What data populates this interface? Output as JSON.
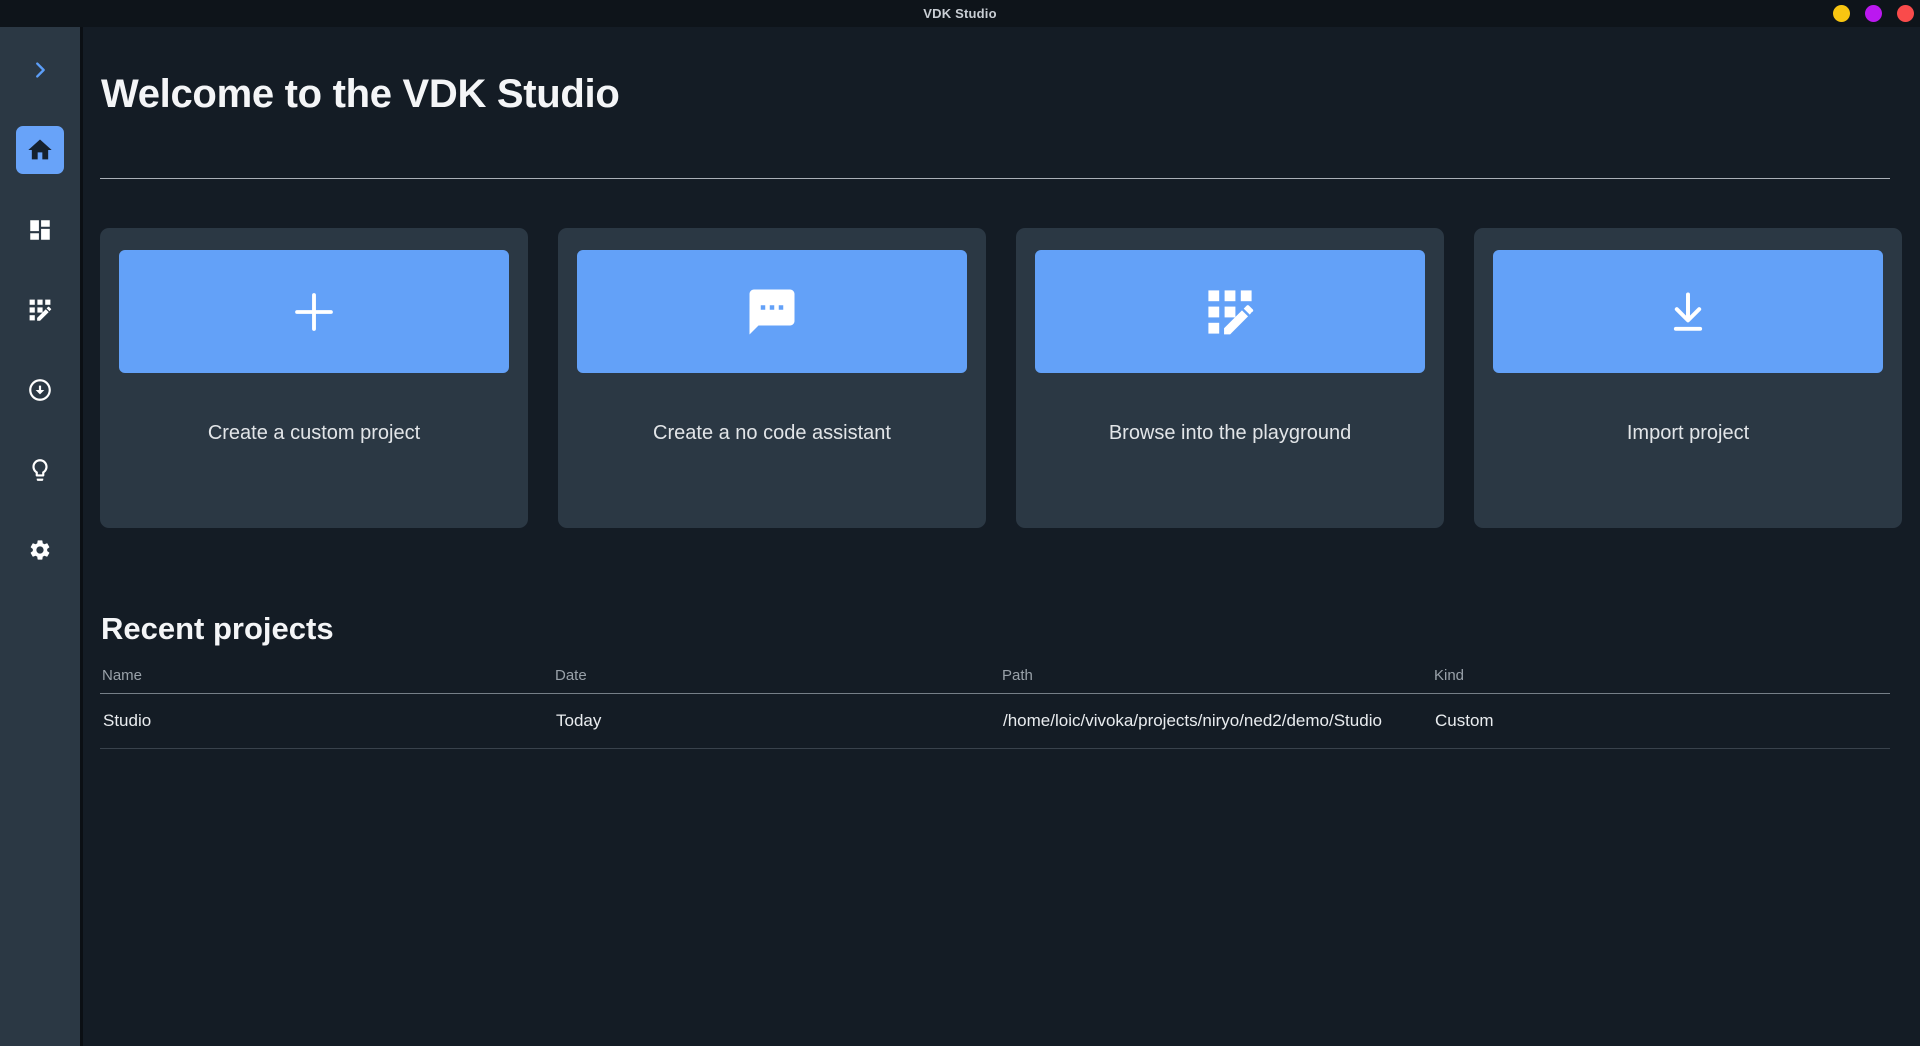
{
  "window": {
    "title": "VDK Studio",
    "controls": {
      "minimize_color": "#f8c511",
      "maximize_color": "#bb18f0",
      "close_color": "#f94b4b"
    }
  },
  "colors": {
    "accent_blue": "#63a1f8",
    "titlebar_bg": "#0e141a",
    "sidebar_bg": "#2b3844",
    "main_bg": "#141c25",
    "card_bg": "#2b3844"
  },
  "sidebar": {
    "items": [
      {
        "name": "expand",
        "icon": "chevron-right-icon",
        "active": false
      },
      {
        "name": "home",
        "icon": "home-icon",
        "active": true
      },
      {
        "name": "dashboard",
        "icon": "dashboard-icon",
        "active": false
      },
      {
        "name": "playground",
        "icon": "grid-edit-icon",
        "active": false
      },
      {
        "name": "downloads",
        "icon": "arrow-circle-down-icon",
        "active": false
      },
      {
        "name": "ideas",
        "icon": "lightbulb-icon",
        "active": false
      },
      {
        "name": "settings",
        "icon": "gear-icon",
        "active": false
      }
    ]
  },
  "main": {
    "heading": "Welcome to the VDK Studio",
    "cards": [
      {
        "icon": "plus-icon",
        "label": "Create a custom project"
      },
      {
        "icon": "chat-icon",
        "label": "Create a no code assistant"
      },
      {
        "icon": "grid-edit-icon",
        "label": "Browse into the playground"
      },
      {
        "icon": "download-icon",
        "label": "Import project"
      }
    ],
    "recent": {
      "heading": "Recent projects",
      "columns": {
        "name": "Name",
        "date": "Date",
        "path": "Path",
        "kind": "Kind"
      },
      "rows": [
        {
          "name": "Studio",
          "date": "Today",
          "path": "/home/loic/vivoka/projects/niryo/ned2/demo/Studio",
          "kind": "Custom"
        }
      ]
    }
  }
}
